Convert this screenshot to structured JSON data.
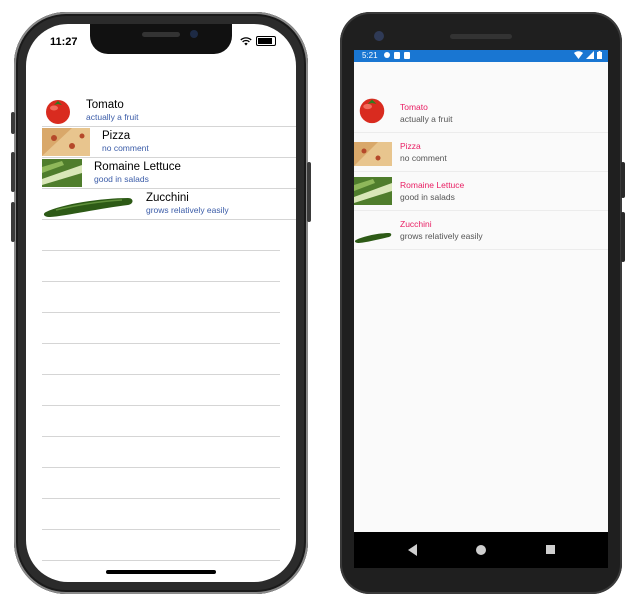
{
  "ios": {
    "time": "11:27",
    "items": [
      {
        "title": "Tomato",
        "detail": "actually a fruit",
        "image": "tomato-image"
      },
      {
        "title": "Pizza",
        "detail": "no comment",
        "image": "pizza-image"
      },
      {
        "title": "Romaine Lettuce",
        "detail": "good in salads",
        "image": "lettuce-image"
      },
      {
        "title": "Zucchini",
        "detail": "grows relatively easily",
        "image": "zucchini-image"
      }
    ]
  },
  "android": {
    "time": "5:21",
    "items": [
      {
        "title": "Tomato",
        "detail": "actually a fruit",
        "image": "tomato-image"
      },
      {
        "title": "Pizza",
        "detail": "no comment",
        "image": "pizza-image"
      },
      {
        "title": "Romaine Lettuce",
        "detail": "good in salads",
        "image": "lettuce-image"
      },
      {
        "title": "Zucchini",
        "detail": "grows relatively easily",
        "image": "zucchini-image"
      }
    ]
  },
  "colors": {
    "android_status_bar": "#1976d2",
    "android_title": "#e91e63",
    "ios_detail": "#3b5ca8"
  }
}
